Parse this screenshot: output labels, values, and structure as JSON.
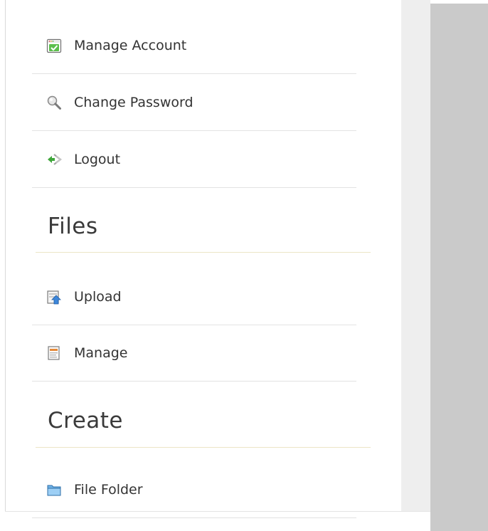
{
  "account_menu": {
    "items": [
      {
        "label": "Manage Account",
        "icon": "account-check-icon"
      },
      {
        "label": "Change Password",
        "icon": "magnifier-key-icon"
      },
      {
        "label": "Logout",
        "icon": "logout-arrow-icon"
      }
    ]
  },
  "files_section": {
    "title": "Files",
    "items": [
      {
        "label": "Upload",
        "icon": "upload-icon"
      },
      {
        "label": "Manage",
        "icon": "manage-files-icon"
      }
    ]
  },
  "create_section": {
    "title": "Create",
    "items": [
      {
        "label": "File Folder",
        "icon": "folder-icon"
      }
    ]
  },
  "colors": {
    "text": "#333333",
    "heading": "#3a3a3a",
    "divider": "#e3e3e3",
    "section_rule": "#ece5c6",
    "side_panel": "#cacaca"
  }
}
